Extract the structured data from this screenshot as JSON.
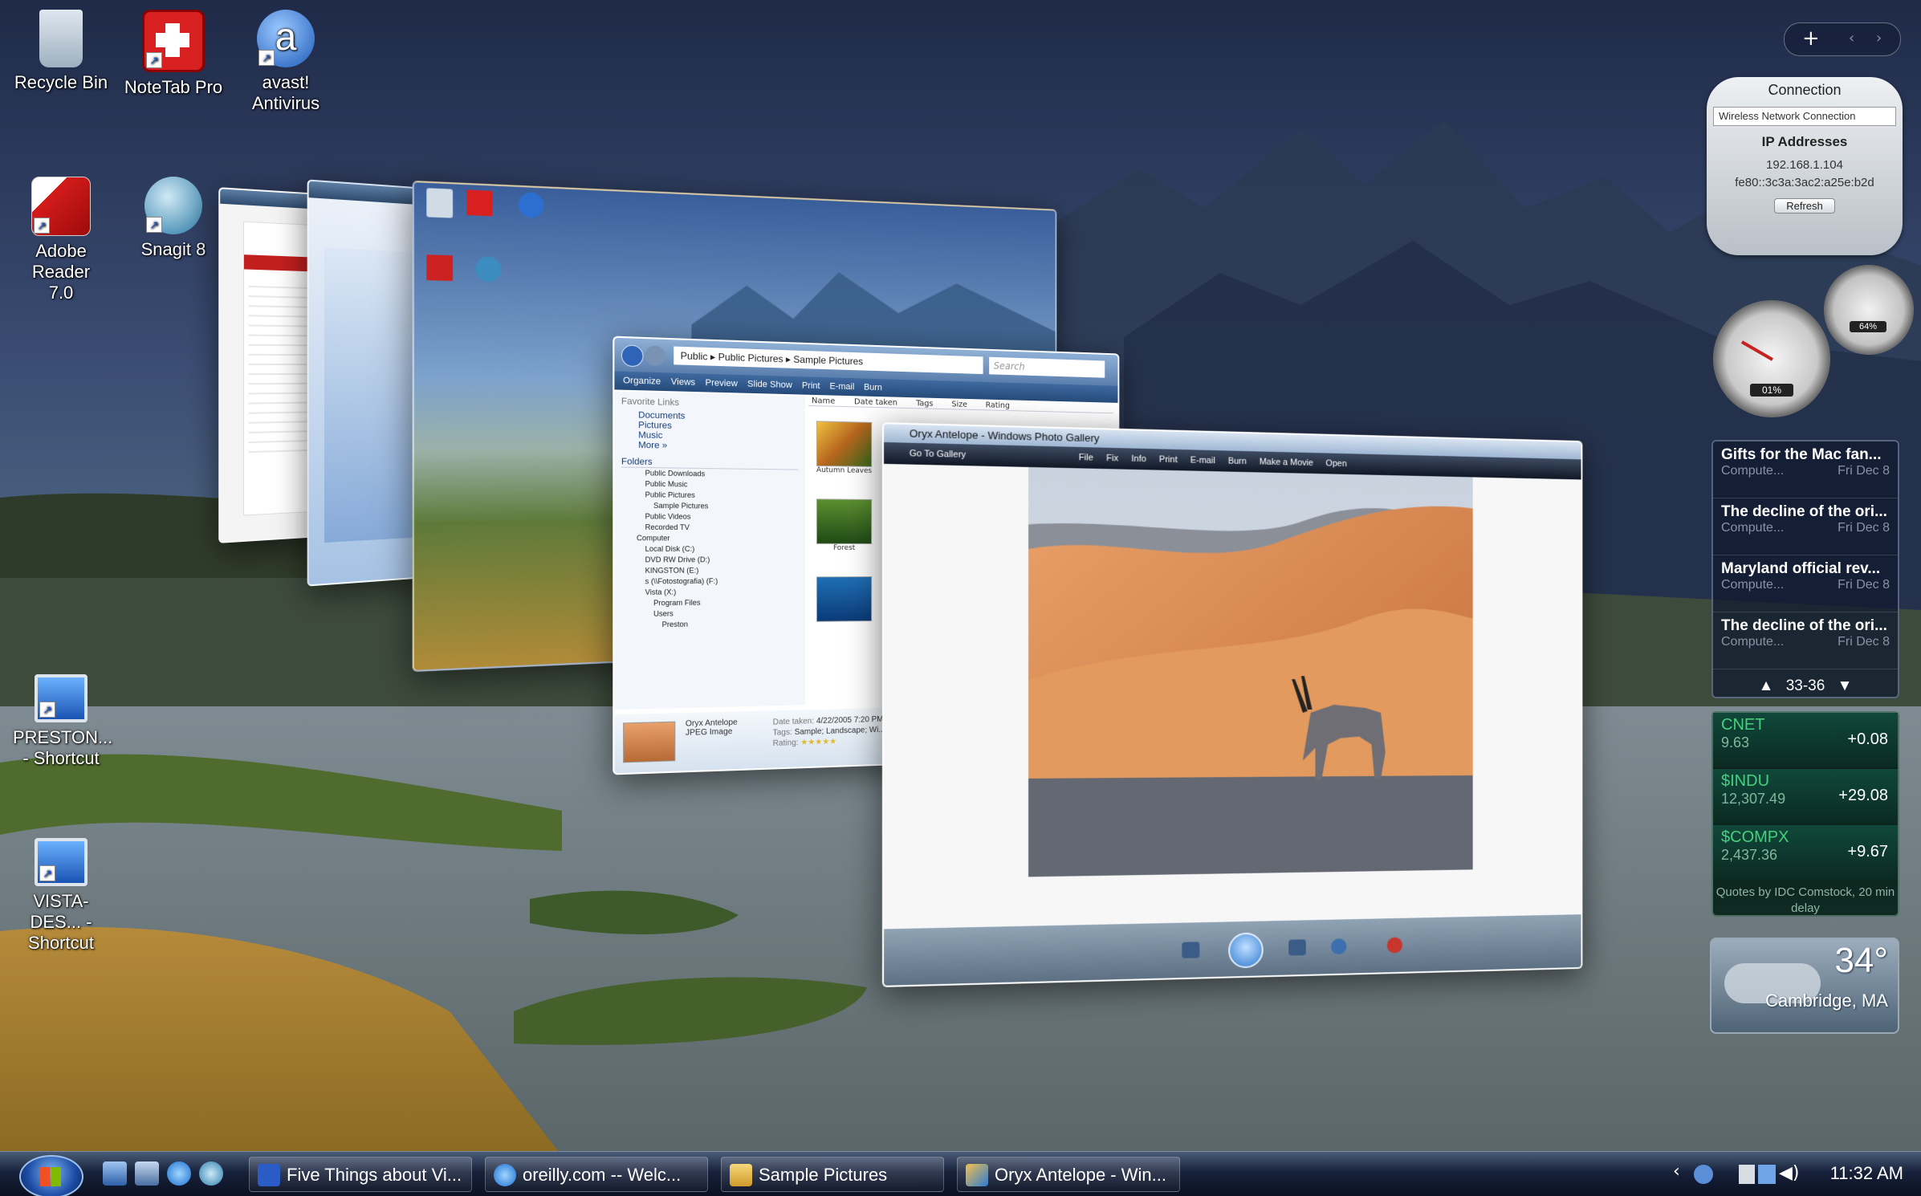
{
  "desktop_icons": [
    {
      "label": "Recycle Bin",
      "icon": "recycle-bin-icon"
    },
    {
      "label": "NoteTab Pro",
      "icon": "notetab-icon"
    },
    {
      "label": "avast! Antivirus",
      "icon": "avast-icon"
    },
    {
      "label": "Adobe Reader 7.0",
      "icon": "adobe-reader-icon"
    },
    {
      "label": "Snagit 8",
      "icon": "snagit-icon"
    },
    {
      "label": "PRESTON... - Shortcut",
      "icon": "computer-shortcut-icon"
    },
    {
      "label": "VISTA-DES... - Shortcut",
      "icon": "computer-shortcut-icon"
    }
  ],
  "flip_windows": {
    "explorer_path": "Public ▸ Public Pictures ▸ Sample Pictures",
    "explorer_search": "Search",
    "explorer_toolbar": [
      "Organize",
      "Views",
      "Preview",
      "Slide Show",
      "Print",
      "E-mail",
      "Burn"
    ],
    "explorer_favorites_title": "Favorite Links",
    "explorer_favorites": [
      "Documents",
      "Pictures",
      "Music",
      "More »"
    ],
    "explorer_folders_title": "Folders",
    "explorer_folders": [
      "Public Downloads",
      "Public Music",
      "Public Pictures",
      "Sample Pictures",
      "Public Videos",
      "Recorded TV",
      "Computer",
      "Local Disk (C:)",
      "DVD RW Drive (D:)",
      "KINGSTON (E:)",
      "s (\\\\Fotostografia) (F:)",
      "Vista (X:)",
      "Program Files",
      "Users",
      "Preston"
    ],
    "explorer_columns": [
      "Name",
      "Date taken",
      "Tags",
      "Size",
      "Rating"
    ],
    "explorer_thumbs": [
      "Autumn Leaves",
      "Forest",
      ""
    ],
    "explorer_details": {
      "name": "Oryx Antelope",
      "type": "JPEG Image",
      "date_label": "Date taken:",
      "date": "4/22/2005 7:20 PM",
      "tags_label": "Tags:",
      "tags": "Sample; Landscape; Wi...",
      "rating_label": "Rating:"
    },
    "gallery_title": "Oryx Antelope - Windows Photo Gallery",
    "gallery_menu": [
      "Go To Gallery",
      "File",
      "Fix",
      "Info",
      "Print",
      "E-mail",
      "Burn",
      "Make a Movie",
      "Open"
    ]
  },
  "gadgets": {
    "network": {
      "title": "Connection",
      "connection": "Wireless Network Connection",
      "ip_title": "IP Addresses",
      "ipv4": "192.168.1.104",
      "ipv6": "fe80::3c3a:3ac2:a25e:b2d",
      "refresh": "Refresh"
    },
    "meters": {
      "cpu": "01%",
      "memory": "64%"
    },
    "feeds": {
      "items": [
        {
          "title": "Gifts for the Mac fan...",
          "source": "Compute...",
          "date": "Fri Dec 8"
        },
        {
          "title": "The decline of the ori...",
          "source": "Compute...",
          "date": "Fri Dec 8"
        },
        {
          "title": "Maryland official rev...",
          "source": "Compute...",
          "date": "Fri Dec 8"
        },
        {
          "title": "The decline of the ori...",
          "source": "Compute...",
          "date": "Fri Dec 8"
        }
      ],
      "pager": "33-36"
    },
    "stocks": {
      "items": [
        {
          "symbol": "CNET",
          "price": "9.63",
          "change": "+0.08"
        },
        {
          "symbol": "$INDU",
          "price": "12,307.49",
          "change": "+29.08"
        },
        {
          "symbol": "$COMPX",
          "price": "2,437.36",
          "change": "+9.67"
        }
      ],
      "note": "Quotes by IDC Comstock, 20 min delay"
    },
    "weather": {
      "temp": "34°",
      "city": "Cambridge, MA"
    }
  },
  "taskbar": {
    "buttons": [
      {
        "label": "Five Things about Vi...",
        "icon": "word-doc-icon"
      },
      {
        "label": "oreilly.com -- Welc...",
        "icon": "internet-explorer-icon"
      },
      {
        "label": "Sample Pictures",
        "icon": "folder-icon"
      },
      {
        "label": "Oryx Antelope - Win...",
        "icon": "photo-gallery-icon"
      }
    ],
    "clock": "11:32 AM"
  },
  "colors": {
    "accent": "#1e4ea7",
    "stock_green": "#45d07d",
    "desert": "#e0925a",
    "sky": "#3a4c72"
  }
}
